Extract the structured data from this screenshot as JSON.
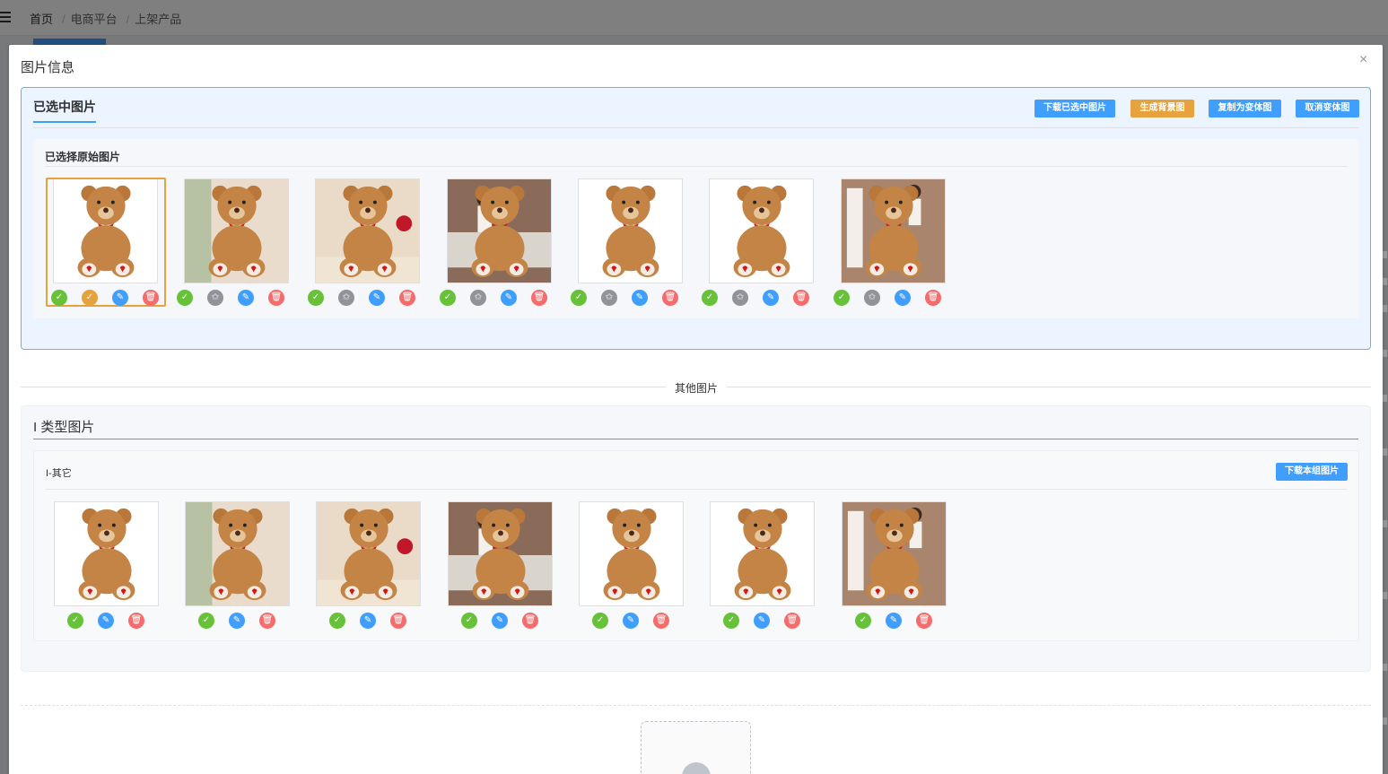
{
  "breadcrumb": [
    "首页",
    "电商平台",
    "上架产品"
  ],
  "dialog": {
    "title": "图片信息",
    "close_label": "×"
  },
  "selected": {
    "title": "已选中图片",
    "buttons": {
      "download": "下载已选中图片",
      "generate_bg": "生成背景图",
      "copy_variant": "复制为变体图",
      "cancel_variant": "取消变体图"
    },
    "original_title": "已选择原始图片",
    "images": [
      "teddy-white-bg",
      "teddy-on-chair",
      "teddy-with-roses",
      "girl-on-sofa-with-teddy",
      "teddy-sitting-white",
      "teddy-front-white",
      "girl-with-teddy-love-blocks"
    ],
    "selected_index": 0
  },
  "divider_label": "其他图片",
  "type_section": {
    "title": "I 类型图片",
    "group_title": "I-其它",
    "download_group": "下载本组图片",
    "images": [
      "teddy-white-bg",
      "teddy-on-chair",
      "teddy-with-roses",
      "girl-on-sofa-with-teddy",
      "teddy-sitting-white",
      "teddy-front-white",
      "girl-with-teddy-love-blocks"
    ]
  },
  "icons": {
    "check": "✓",
    "star": "✩",
    "edit": "✎",
    "delete": "🗑"
  },
  "colors": {
    "primary": "#409eff",
    "warning": "#e6a23c",
    "success": "#67c23a",
    "danger": "#f56c6c",
    "info": "#909399"
  }
}
